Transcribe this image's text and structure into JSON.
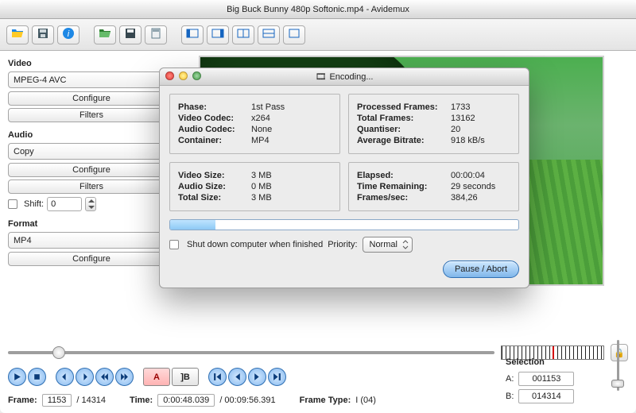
{
  "window": {
    "title": "Big Buck Bunny 480p Softonic.mp4 - Avidemux"
  },
  "sidebar": {
    "video": {
      "title": "Video",
      "codec": "MPEG-4 AVC"
    },
    "audio": {
      "title": "Audio",
      "codec": "Copy",
      "shift_label": "Shift:",
      "shift_value": "0"
    },
    "format": {
      "title": "Format",
      "value": "MP4"
    },
    "buttons": {
      "configure": "Configure",
      "filters": "Filters"
    }
  },
  "status": {
    "frame_label": "Frame:",
    "frame": "1153",
    "frame_total": "/ 14314",
    "time_label": "Time:",
    "time": "0:00:48.039",
    "time_total": "/ 00:09:56.391",
    "frametype_label": "Frame Type:",
    "frametype": "I (04)"
  },
  "selection": {
    "title": "Selection",
    "a_label": "A:",
    "a": "001153",
    "b_label": "B:",
    "b": "014314"
  },
  "dialog": {
    "title": "Encoding...",
    "info": {
      "phase_k": "Phase:",
      "phase": "1st Pass",
      "vcodec_k": "Video Codec:",
      "vcodec": "x264",
      "acodec_k": "Audio Codec:",
      "acodec": "None",
      "container_k": "Container:",
      "container": "MP4"
    },
    "prog": {
      "pframes_k": "Processed Frames:",
      "pframes": "1733",
      "tframes_k": "Total Frames:",
      "tframes": "13162",
      "quant_k": "Quantiser:",
      "quant": "20",
      "abr_k": "Average Bitrate:",
      "abr": "918 kB/s"
    },
    "size": {
      "vs_k": "Video Size:",
      "vs": "3 MB",
      "as_k": "Audio Size:",
      "as": "0 MB",
      "ts_k": "Total Size:",
      "ts": "3 MB"
    },
    "time": {
      "el_k": "Elapsed:",
      "el": "00:00:04",
      "tr_k": "Time Remaining:",
      "tr": "29 seconds",
      "fps_k": "Frames/sec:",
      "fps": "384,26"
    },
    "shutdown_label": "Shut down computer when finished",
    "priority_label": "Priority:",
    "priority_value": "Normal",
    "pause_abort": "Pause / Abort"
  }
}
